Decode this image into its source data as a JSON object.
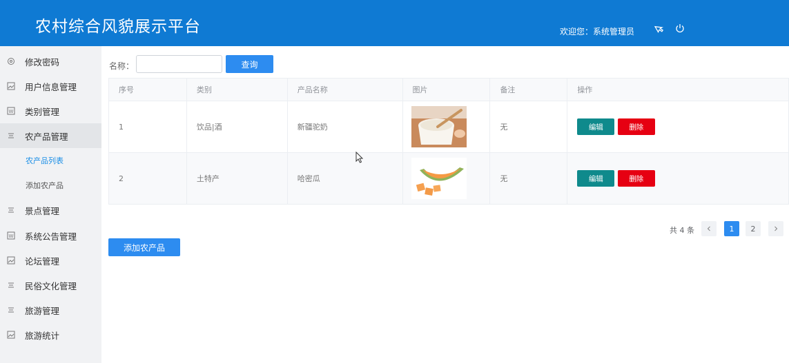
{
  "header": {
    "title": "农村综合风貌展示平台",
    "welcome": "欢迎您：系统管理员",
    "theme_icon": "theme-icon",
    "power_icon": "power-icon",
    "bg_color": "#0f7ad3"
  },
  "sidebar": {
    "items": [
      {
        "label": "修改密码",
        "icon": "settings-icon"
      },
      {
        "label": "用户信息管理",
        "icon": "image-icon"
      },
      {
        "label": "类别管理",
        "icon": "word-icon"
      },
      {
        "label": "农产品管理",
        "icon": "list-icon"
      },
      {
        "label": "景点管理",
        "icon": "list-icon"
      },
      {
        "label": "系统公告管理",
        "icon": "word-icon"
      },
      {
        "label": "论坛管理",
        "icon": "image-icon"
      },
      {
        "label": "民俗文化管理",
        "icon": "list-icon"
      },
      {
        "label": "旅游管理",
        "icon": "list-icon"
      },
      {
        "label": "旅游统计",
        "icon": "image-icon"
      }
    ],
    "sub_items": [
      {
        "label": "农产品列表"
      },
      {
        "label": "添加农产品"
      }
    ]
  },
  "search": {
    "label": "名称：",
    "value": "",
    "button": "查询"
  },
  "table": {
    "headers": [
      "序号",
      "类别",
      "产品名称",
      "图片",
      "备注",
      "操作"
    ],
    "rows": [
      {
        "id": "1",
        "category": "饮品|酒",
        "name": "新疆驼奶",
        "image": "milk-image",
        "note": "无",
        "edit": "编辑",
        "delete": "删除"
      },
      {
        "id": "2",
        "category": "土特产",
        "name": "哈密瓜",
        "image": "melon-image",
        "note": "无",
        "edit": "编辑",
        "delete": "删除"
      }
    ]
  },
  "pagination": {
    "total": "共 4 条",
    "pages": [
      "1",
      "2"
    ],
    "current": "1"
  },
  "add_button": "添加农产品",
  "colors": {
    "primary": "#2d8cf0",
    "edit": "#0f8a8c",
    "delete": "#e60012"
  }
}
